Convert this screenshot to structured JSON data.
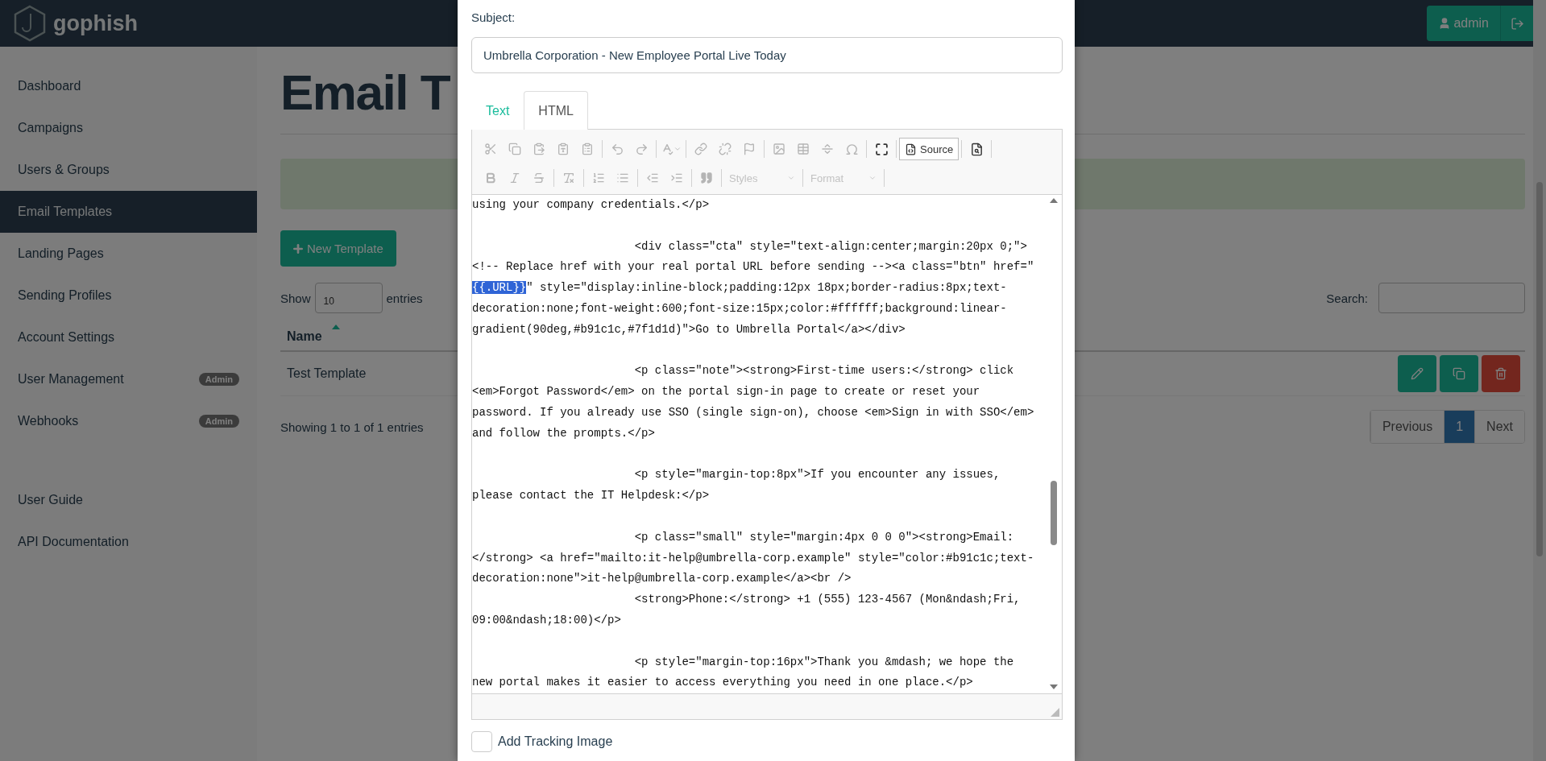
{
  "header": {
    "brand": "gophish",
    "user_button": "admin"
  },
  "sidebar": {
    "items": [
      {
        "label": "Dashboard",
        "selected": false
      },
      {
        "label": "Campaigns",
        "selected": false
      },
      {
        "label": "Users & Groups",
        "selected": false
      },
      {
        "label": "Email Templates",
        "selected": true
      },
      {
        "label": "Landing Pages",
        "selected": false
      },
      {
        "label": "Sending Profiles",
        "selected": false
      },
      {
        "label": "Account Settings",
        "selected": false
      },
      {
        "label": "User Management",
        "selected": false,
        "badge": "Admin"
      },
      {
        "label": "Webhooks",
        "selected": false,
        "badge": "Admin"
      }
    ],
    "links": [
      "User Guide",
      "API Documentation"
    ]
  },
  "page": {
    "title": "Email T",
    "new_button": "New Template",
    "show_label": "Show",
    "entries_value": "10",
    "entries_label": "entries",
    "search_label": "Search:",
    "table": {
      "columns": [
        {
          "label": "Name",
          "sorted": true
        }
      ],
      "rows": [
        {
          "name": "Test Template"
        }
      ]
    },
    "info": "Showing 1 to 1 of 1 entries",
    "pagination": [
      {
        "label": "Previous",
        "selected": false
      },
      {
        "label": "1",
        "selected": true
      },
      {
        "label": "Next",
        "selected": false
      }
    ]
  },
  "modal": {
    "subject_label": "Subject:",
    "subject_value": "Umbrella Corporation - New Employee Portal Live Today",
    "tabs": [
      {
        "label": "Text",
        "selected": false
      },
      {
        "label": "HTML",
        "selected": true
      }
    ],
    "toolbar": {
      "source_label": "Source",
      "styles_label": "Styles",
      "format_label": "Format"
    },
    "code_blocks": [
      [
        {
          "text": "using your company credentials.</p>"
        }
      ],
      [
        {
          "text": "                        <div class=\"cta\" style=\"text-align:center;margin:20px 0;\">"
        },
        {
          "text": "<!-- Replace href with your real portal URL before sending --><a class=\"btn\" href=\""
        },
        {
          "segments": [
            {
              "text": "{{.URL}}",
              "selected": true
            },
            {
              "text": "\" style=\"display:inline-block;padding:12px 18px;border-radius:8px;text-",
              "selected": false
            }
          ]
        },
        {
          "text": "decoration:none;font-weight:600;font-size:15px;color:#ffffff;background:linear-"
        },
        {
          "text": "gradient(90deg,#b91c1c,#7f1d1d)\">Go to Umbrella Portal</a></div>"
        }
      ],
      [
        {
          "text": "                        <p class=\"note\"><strong>First-time users:</strong> click"
        },
        {
          "text": "<em>Forgot Password</em> on the portal sign-in page to create or reset your"
        },
        {
          "text": "password. If you already use SSO (single sign-on), choose <em>Sign in with SSO</em>"
        },
        {
          "text": "and follow the prompts.</p>"
        }
      ],
      [
        {
          "text": "                        <p style=\"margin-top:8px\">If you encounter any issues,"
        },
        {
          "text": "please contact the IT Helpdesk:</p>"
        }
      ],
      [
        {
          "text": "                        <p class=\"small\" style=\"margin:4px 0 0 0\"><strong>Email:"
        },
        {
          "text": "</strong> <a href=\"mailto:it-help@umbrella-corp.example\" style=\"color:#b91c1c;text-"
        },
        {
          "text": "decoration:none\">it-help@umbrella-corp.example</a><br />"
        },
        {
          "text": "                        <strong>Phone:</strong> +1 (555) 123-4567 (Mon&ndash;Fri,"
        },
        {
          "text": "09:00&ndash;18:00)</p>"
        }
      ],
      [
        {
          "text": "                        <p style=\"margin-top:16px\">Thank you &mdash; we hope the"
        },
        {
          "text": "new portal makes it easier to access everything you need in one place.</p>"
        }
      ]
    ],
    "tracking": {
      "label": "Add Tracking Image",
      "checked": false
    }
  }
}
